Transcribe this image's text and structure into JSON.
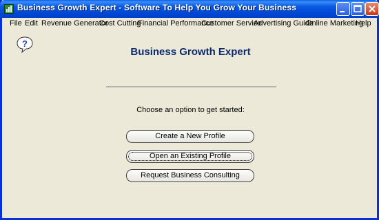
{
  "window": {
    "title": "Business Growth Expert - Software To Help You Grow Your Business"
  },
  "menu": [
    {
      "label": "File"
    },
    {
      "label": "Edit"
    },
    {
      "label": "Revenue Generator"
    },
    {
      "label": "Cost Cutting"
    },
    {
      "label": "Financial Performance"
    },
    {
      "label": "Customer Service"
    },
    {
      "label": "Advertising Guide"
    },
    {
      "label": "Online Marketing"
    },
    {
      "label": "Help"
    }
  ],
  "main": {
    "title": "Business Growth Expert",
    "prompt": "Choose an option to get started:",
    "buttons": [
      {
        "label": "Create a New Profile"
      },
      {
        "label": "Open an Existing Profile"
      },
      {
        "label": "Request Business Consulting"
      }
    ]
  },
  "icons": {
    "app": "app-icon",
    "help": "help-icon",
    "minimize": "minimize-icon",
    "maximize": "maximize-icon",
    "close": "close-icon"
  },
  "colors": {
    "titlebar": "#0B5BE0",
    "heading": "#0B2A6F",
    "background": "#ECE9D8"
  }
}
